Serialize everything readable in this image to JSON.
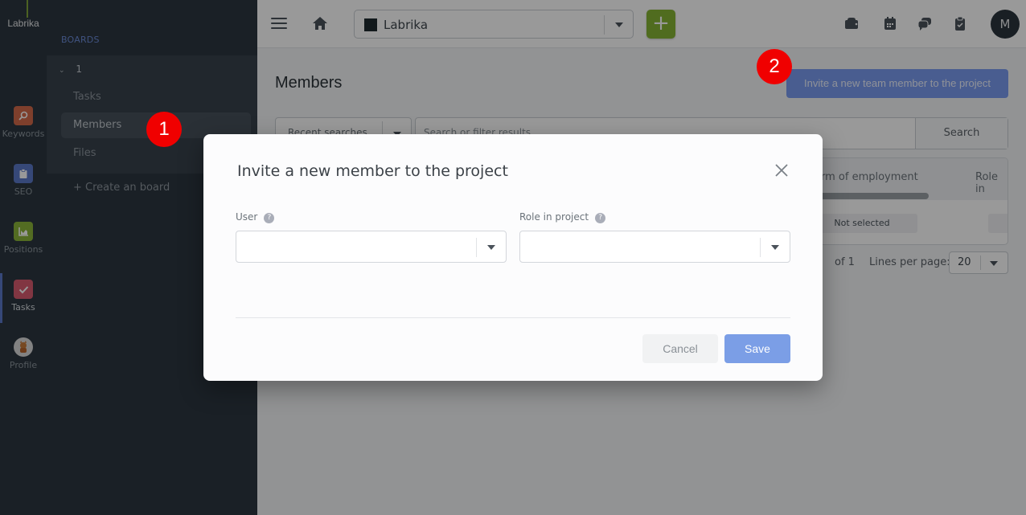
{
  "rail": {
    "logo": "Labrika",
    "items": [
      {
        "label": "Keywords",
        "icon": "key-search-icon",
        "color": "#d2694a"
      },
      {
        "label": "SEO",
        "icon": "clipboard-icon",
        "color": "#5b78c8"
      },
      {
        "label": "Positions",
        "icon": "chart-icon",
        "color": "#8ab43a"
      },
      {
        "label": "Tasks",
        "icon": "check-icon",
        "color": "#d85a6e"
      },
      {
        "label": "Profile",
        "icon": "avatar-icon",
        "color": "#d9d9d9"
      }
    ],
    "active": "Tasks"
  },
  "boards": {
    "section_title": "BOARDS",
    "group_name": "1",
    "items": [
      {
        "label": "Tasks"
      },
      {
        "label": "Members"
      },
      {
        "label": "Files"
      }
    ],
    "active_item": "Members",
    "create_label": "+ Create an board"
  },
  "topbar": {
    "project_name": "Labrika",
    "add_label": "+",
    "avatar_initial": "M",
    "icons": [
      "wallet-icon",
      "calendar-icon",
      "chat-icon",
      "clipboard-check-icon"
    ]
  },
  "main": {
    "page_title": "Members",
    "invite_button": "Invite a new team member to the project",
    "recent_searches": "Recent searches",
    "search_placeholder": "Search or filter results...",
    "search_button": "Search",
    "table": {
      "columns": [
        "rm of employment",
        "Role in"
      ],
      "cell_value": "Not selected"
    },
    "pager": {
      "of_label": "of 1",
      "lines_label": "Lines per page:",
      "lines_value": "20"
    }
  },
  "badges": {
    "step1": "1",
    "step2": "2"
  },
  "modal": {
    "title": "Invite a new member to the project",
    "user_label": "User",
    "user_value": "",
    "role_label": "Role in project",
    "role_value": "",
    "help_glyph": "?",
    "cancel_label": "Cancel",
    "save_label": "Save"
  },
  "colors": {
    "accent_blue": "#7b9cf0",
    "add_green": "#86b534",
    "badge_red": "#f00000"
  }
}
